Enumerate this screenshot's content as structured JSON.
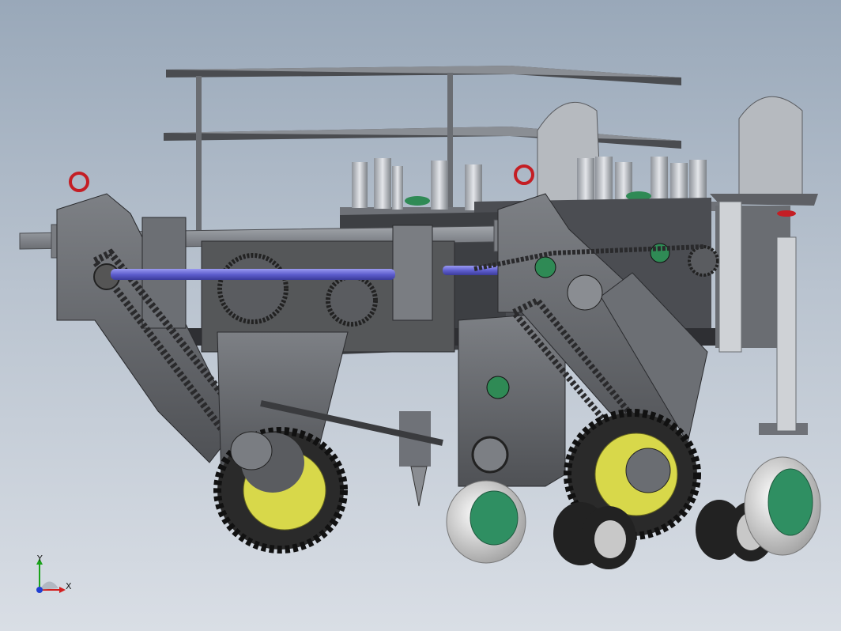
{
  "viewport": {
    "background_top": "#99a8b9",
    "background_bottom": "#d9dee5"
  },
  "model": {
    "description_icon": "agricultural-seeder-machine-icon",
    "frame_color": "#5d5f62",
    "steel_light": "#b8bcc2",
    "chain_color": "#2a2a2c",
    "shaft_color": "#6f6fd8",
    "bearing_color": "#2f8a55",
    "tire_color": "#2a2a2a",
    "rim_yellow": "#d8d84a",
    "rim_green": "#2f8f62",
    "caster_tire": "#e8e8e8",
    "valve_red": "#c41e24"
  },
  "triad": {
    "x_label": "X",
    "y_label": "Y",
    "x_color": "#d21f1f",
    "y_color": "#1aa31a",
    "z_color": "#1f3fd2"
  }
}
